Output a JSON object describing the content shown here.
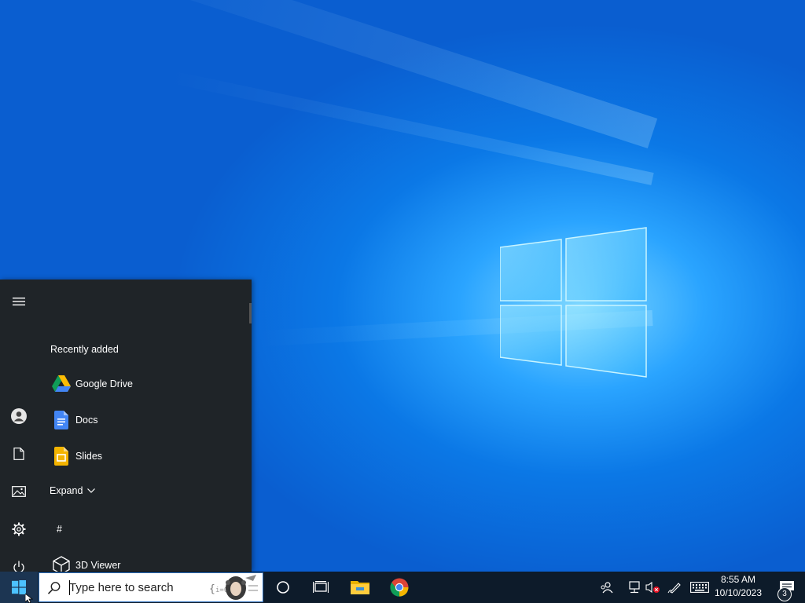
{
  "desktop": {
    "wallpaper": "windows-10-hero",
    "accent": "#0a78e6"
  },
  "start_menu": {
    "rail": [
      {
        "name": "hamburger-menu-icon"
      },
      {
        "name": "user-account-icon"
      },
      {
        "name": "documents-icon"
      },
      {
        "name": "pictures-icon"
      },
      {
        "name": "settings-gear-icon"
      },
      {
        "name": "power-icon"
      }
    ],
    "section_title": "Recently added",
    "recent_apps": [
      {
        "label": "Google Drive",
        "icon": "google-drive-icon"
      },
      {
        "label": "Docs",
        "icon": "google-docs-icon"
      },
      {
        "label": "Slides",
        "icon": "google-slides-icon"
      }
    ],
    "expand_label": "Expand",
    "letter_header": "#",
    "all_apps": [
      {
        "label": "3D Viewer",
        "icon": "3d-viewer-icon"
      }
    ]
  },
  "taskbar": {
    "search": {
      "placeholder": "Type here to search"
    },
    "pinned": [
      {
        "name": "cortana-icon"
      },
      {
        "name": "task-view-icon"
      },
      {
        "name": "file-explorer-icon"
      },
      {
        "name": "chrome-icon"
      }
    ],
    "clock": {
      "time": "8:55 AM",
      "date": "10/10/2023"
    },
    "notification_count": "3"
  }
}
